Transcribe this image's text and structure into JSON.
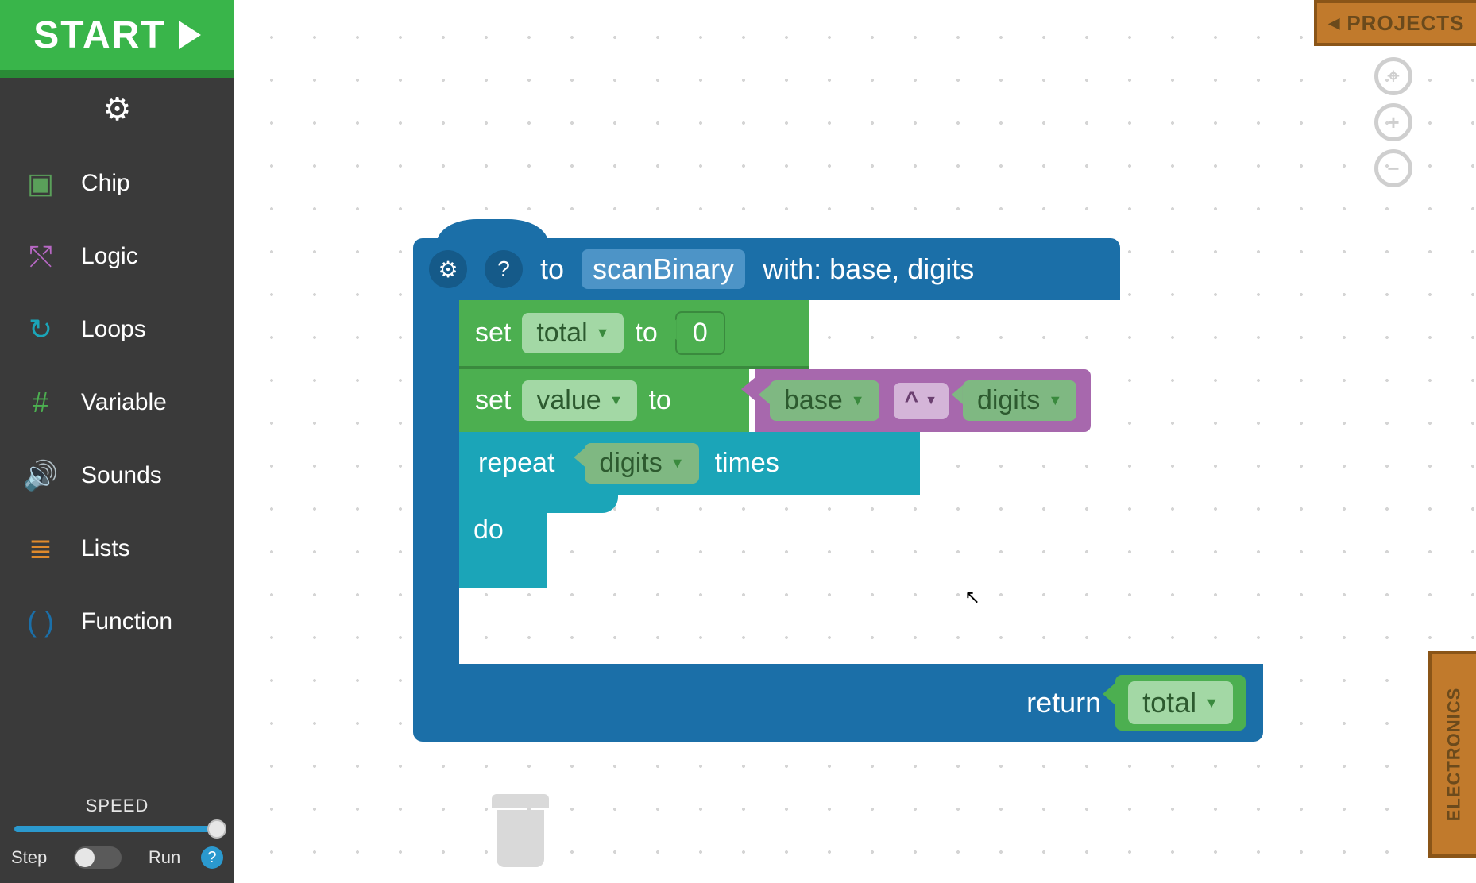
{
  "header": {
    "start_label": "START"
  },
  "sidebar": {
    "categories": [
      {
        "label": "Chip",
        "color": "#5aa05a",
        "icon": "chip-icon",
        "glyph": "⬛"
      },
      {
        "label": "Logic",
        "color": "#b768c4",
        "icon": "logic-icon",
        "glyph": "⎌"
      },
      {
        "label": "Loops",
        "color": "#1ba5b8",
        "icon": "loops-icon",
        "glyph": "↻"
      },
      {
        "label": "Variable",
        "color": "#4caf50",
        "icon": "variable-icon",
        "glyph": "#"
      },
      {
        "label": "Sounds",
        "color": "#e08a2c",
        "icon": "sounds-icon",
        "glyph": "🔊"
      },
      {
        "label": "Lists",
        "color": "#e08a2c",
        "icon": "lists-icon",
        "glyph": "≡"
      },
      {
        "label": "Function",
        "color": "#1b6fa8",
        "icon": "function-icon",
        "glyph": "( )"
      }
    ],
    "speed": {
      "label": "SPEED",
      "left": "Step",
      "right": "Run",
      "help": "?"
    }
  },
  "tabs": {
    "projects": "PROJECTS",
    "electronics": "ELECTRONICS"
  },
  "function_block": {
    "to_label": "to",
    "name": "scanBinary",
    "with_label": "with: base, digits",
    "set_label": "set",
    "to_keyword": "to",
    "var_total": "total",
    "total_init": "0",
    "var_value": "value",
    "math": {
      "left": "base",
      "op": "^",
      "right": "digits"
    },
    "repeat": {
      "label_repeat": "repeat",
      "count_var": "digits",
      "label_times": "times",
      "label_do": "do"
    },
    "return_label": "return",
    "return_var": "total"
  }
}
